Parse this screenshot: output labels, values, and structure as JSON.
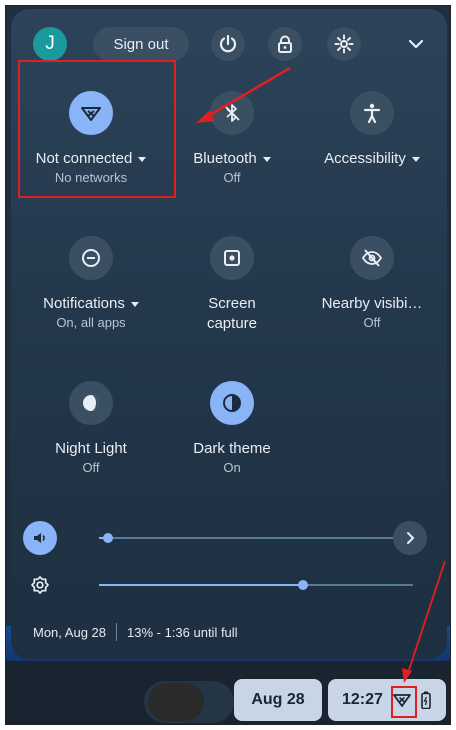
{
  "header": {
    "avatar_initial": "J",
    "sign_out_label": "Sign out"
  },
  "tiles": [
    {
      "label": "Not connected",
      "sub": "No networks",
      "dropdown": true,
      "active": true,
      "icon": "wifi-off-icon"
    },
    {
      "label": "Bluetooth",
      "sub": "Off",
      "dropdown": true,
      "active": false,
      "icon": "bluetooth-off-icon"
    },
    {
      "label": "Accessibility",
      "sub": "",
      "dropdown": true,
      "active": false,
      "icon": "accessibility-icon"
    },
    {
      "label": "Notifications",
      "sub": "On, all apps",
      "dropdown": true,
      "active": false,
      "icon": "notifications-icon"
    },
    {
      "label": "Screen",
      "sub": "capture",
      "dropdown": false,
      "active": false,
      "icon": "screen-capture-icon"
    },
    {
      "label": "Nearby visibi…",
      "sub": "Off",
      "dropdown": false,
      "active": false,
      "icon": "nearby-visibility-off-icon"
    },
    {
      "label": "Night Light",
      "sub": "Off",
      "dropdown": false,
      "active": false,
      "icon": "night-light-icon"
    },
    {
      "label": "Dark theme",
      "sub": "On",
      "dropdown": false,
      "active": true,
      "icon": "dark-theme-icon"
    }
  ],
  "sliders": {
    "volume_level": 0.03,
    "brightness_level": 0.65
  },
  "status": {
    "date": "Mon, Aug 28",
    "battery": "13% - 1:36 until full"
  },
  "shelf": {
    "date": "Aug 28",
    "time": "12:27"
  },
  "colors": {
    "accent": "#8ab4f8",
    "annotation": "#e02020",
    "avatar": "#1a9a9c"
  }
}
